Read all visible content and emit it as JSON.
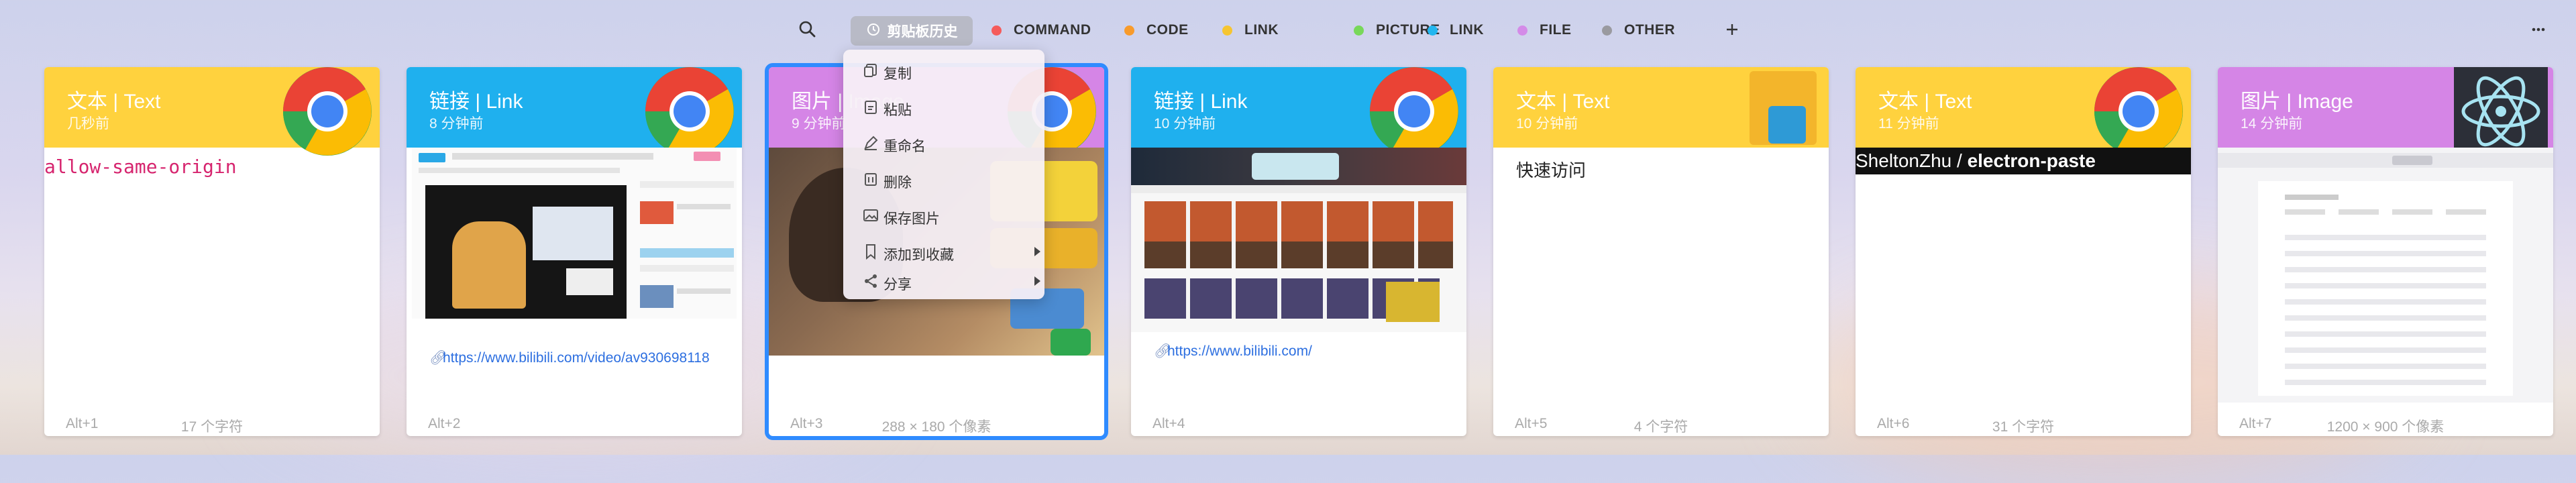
{
  "colors": {
    "accent_selected": "#2f8bff",
    "text_header": "#ffd23e",
    "link_header": "#1fb0ee",
    "image_header": "#d585e6"
  },
  "topbar": {
    "search_icon": "search-icon",
    "history_label": "剪贴板历史",
    "categories": [
      {
        "label": "COMMAND",
        "color": "#f55b5b"
      },
      {
        "label": "CODE",
        "color": "#f89b2b"
      },
      {
        "label": "LINK",
        "color": "#f6c531"
      },
      {
        "label": "PICTURE",
        "color": "#78d85a"
      },
      {
        "label": "LINK",
        "color": "#22b6ef"
      },
      {
        "label": "FILE",
        "color": "#d48be8"
      },
      {
        "label": "OTHER",
        "color": "#9a9aa0"
      }
    ],
    "add_icon": "plus-icon",
    "more_icon": "more-icon"
  },
  "cards": [
    {
      "title": "文本 | Text",
      "time": "几秒前",
      "shortcut": "Alt+1",
      "info": "17 个字符",
      "content": "allow-same-origin"
    },
    {
      "title": "链接 | Link",
      "time": "8 分钟前",
      "shortcut": "Alt+2",
      "info": "",
      "url": "https://www.bilibili.com/video/av930698118"
    },
    {
      "title": "图片 | Image",
      "time": "9 分钟前",
      "shortcut": "Alt+3",
      "info": "288 × 180 个像素"
    },
    {
      "title": "链接 | Link",
      "time": "10 分钟前",
      "shortcut": "Alt+4",
      "info": "",
      "url": "https://www.bilibili.com/"
    },
    {
      "title": "文本 | Text",
      "time": "10 分钟前",
      "shortcut": "Alt+5",
      "info": "4 个字符",
      "content": "快速访问"
    },
    {
      "title": "文本 | Text",
      "time": "11 分钟前",
      "shortcut": "Alt+6",
      "info": "31 个字符",
      "content_user": "SheltonZhu / ",
      "content_repo": "electron-paste"
    },
    {
      "title": "图片 | Image",
      "time": "14 分钟前",
      "shortcut": "Alt+7",
      "info": "1200 × 900 个像素"
    }
  ],
  "menu": {
    "items": [
      {
        "label": "复制",
        "icon": "copy-icon"
      },
      {
        "label": "粘贴",
        "icon": "paste-icon"
      },
      {
        "label": "重命名",
        "icon": "rename-icon"
      },
      {
        "label": "删除",
        "icon": "delete-icon"
      },
      {
        "label": "保存图片",
        "icon": "image-icon"
      },
      {
        "label": "添加到收藏",
        "icon": "bookmark-icon"
      },
      {
        "label": "分享",
        "icon": "share-icon"
      }
    ]
  }
}
